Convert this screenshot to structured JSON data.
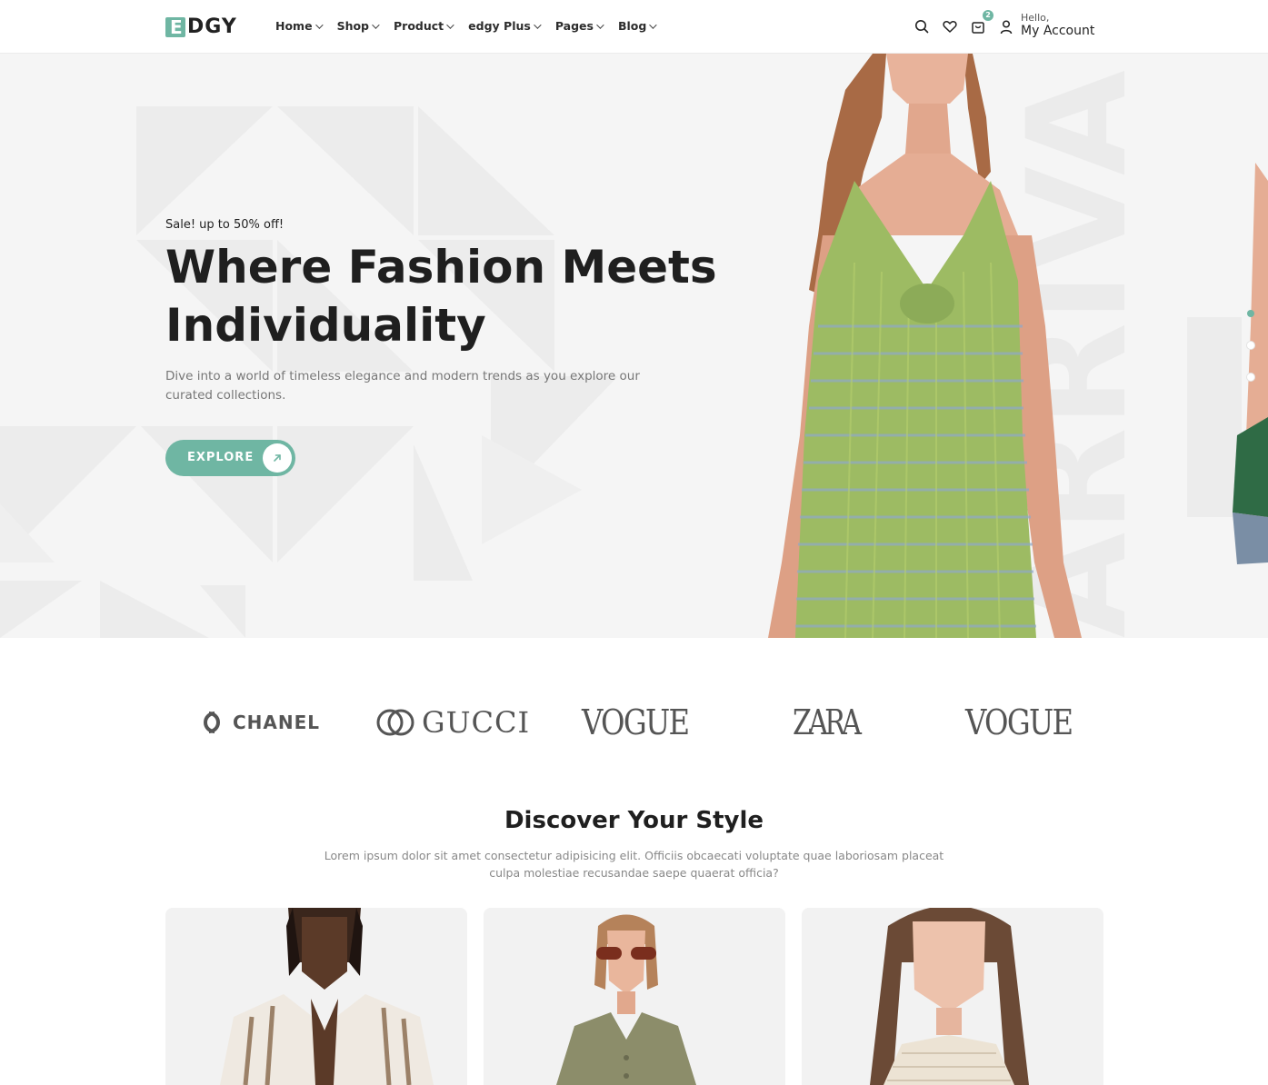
{
  "header": {
    "logo_letter": "E",
    "logo_rest": "DGY",
    "nav": [
      "Home",
      "Shop",
      "Product",
      "edgy Plus",
      "Pages",
      "Blog"
    ],
    "icons": [
      "search-icon",
      "heart-icon",
      "cart-icon",
      "user-icon"
    ],
    "cart_count": "2",
    "account_greeting": "Hello,",
    "account_label": "My Account"
  },
  "hero": {
    "sale_text": "Sale! up to 50% off!",
    "title_line1": "Where Fashion Meets",
    "title_line2": "Individuality",
    "description": "Dive into a world of timeless elegance and modern trends as you explore our curated collections.",
    "button_label": "EXPLORE",
    "watermark": "ARRIVA",
    "slides": 3,
    "active_slide": 1
  },
  "brands": [
    "CHANEL",
    "GUCCI",
    "VOGUE",
    "ZARA",
    "VOGUE"
  ],
  "discover": {
    "title": "Discover Your Style",
    "description": "Lorem ipsum dolor sit amet consectetur adipisicing elit. Officiis obcaecati voluptate quae laboriosam placeat culpa molestiae recusandae saepe quaerat officia?"
  },
  "colors": {
    "accent": "#6fb6a3",
    "hero_bg": "#f5f5f5",
    "text_dark": "#1f1f1f",
    "text_muted": "#777777"
  }
}
